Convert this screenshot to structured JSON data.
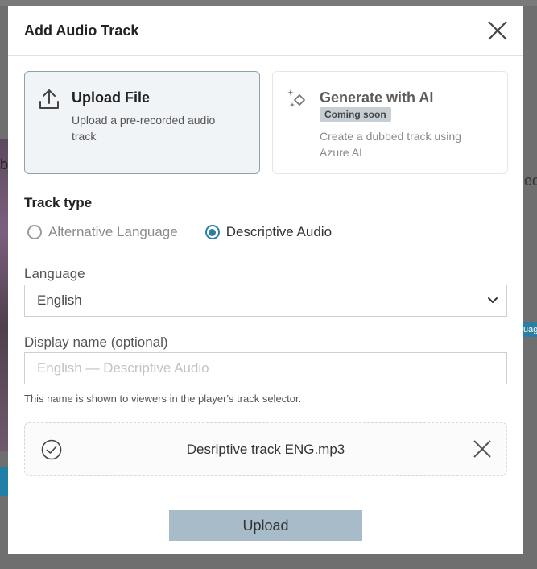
{
  "background": {
    "left_text": "b",
    "right_text": "ed",
    "right_badge": "uag"
  },
  "modal": {
    "title": "Add Audio Track",
    "cards": {
      "upload": {
        "title": "Upload File",
        "description": "Upload a pre-recorded audio track",
        "icon": "upload-icon"
      },
      "generate": {
        "title": "Generate with AI",
        "badge": "Coming soon",
        "description": "Create a dubbed track using Azure AI",
        "icon": "sparkle-icon"
      }
    },
    "track_type": {
      "label": "Track type",
      "options": [
        {
          "label": "Alternative Language",
          "selected": false
        },
        {
          "label": "Descriptive Audio",
          "selected": true
        }
      ]
    },
    "language": {
      "label": "Language",
      "value": "English"
    },
    "display_name": {
      "label": "Display name (optional)",
      "placeholder": "English — Descriptive Audio",
      "value": "",
      "help": "This name is shown to viewers in the player's track selector."
    },
    "file": {
      "name": "Desriptive track ENG.mp3"
    },
    "upload_button": "Upload"
  },
  "colors": {
    "accent": "#2a7fa3",
    "upload_button": "#a7bcc8",
    "selected_card_border": "#8ea1ad"
  }
}
